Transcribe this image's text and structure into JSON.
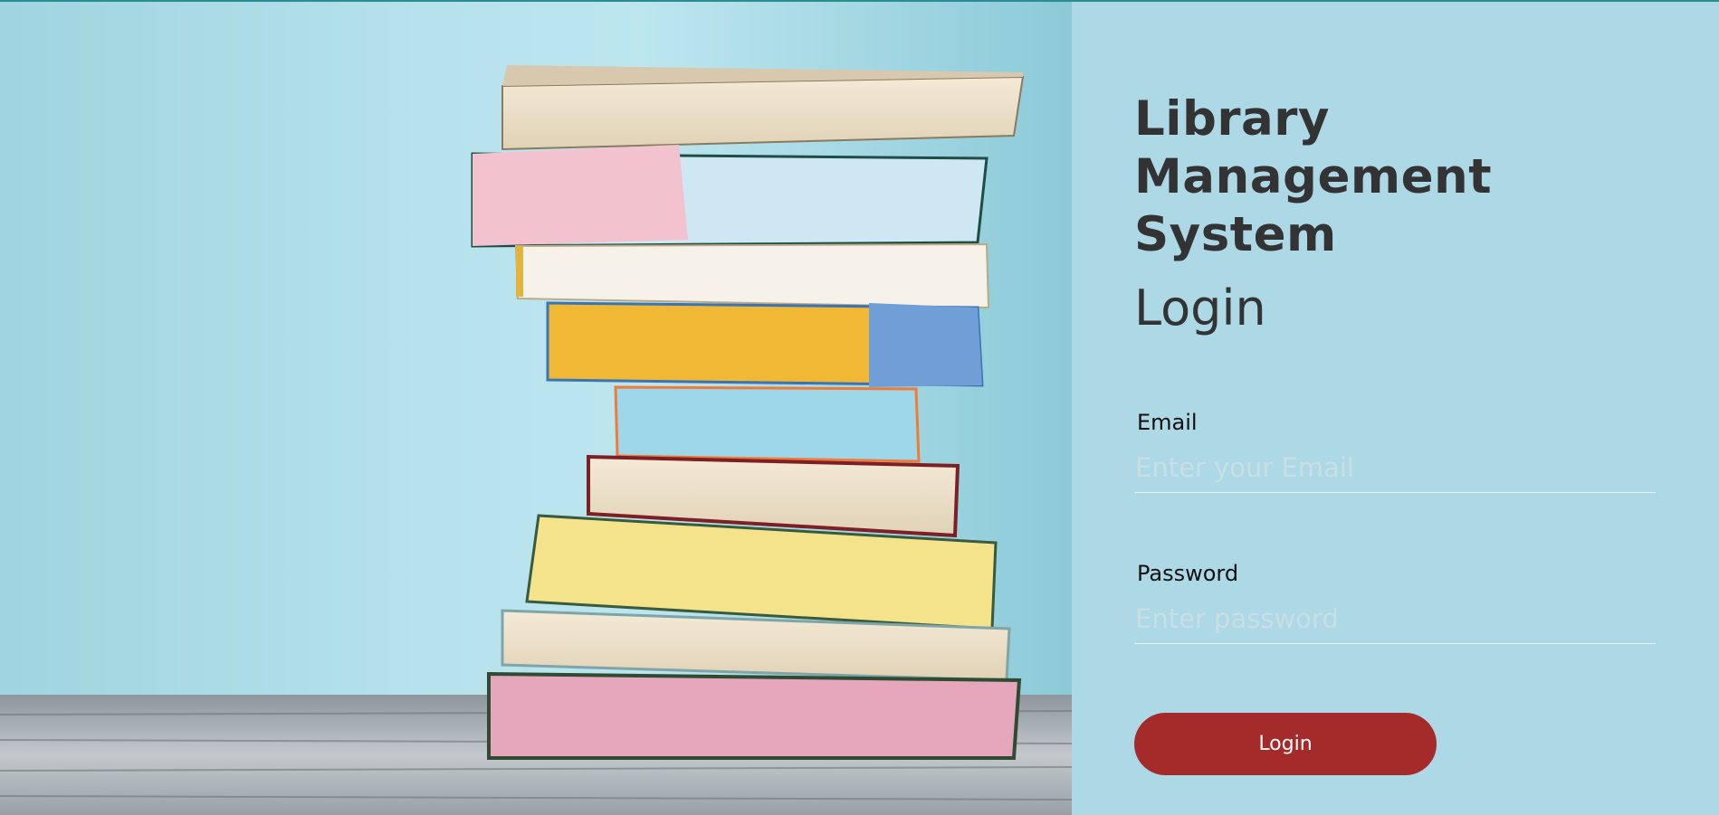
{
  "app": {
    "title": "Library Management System"
  },
  "login": {
    "heading": "Login",
    "email": {
      "label": "Email",
      "placeholder": "Enter your Email",
      "value": ""
    },
    "password": {
      "label": "Password",
      "placeholder": "Enter password",
      "value": ""
    },
    "submit_label": "Login"
  },
  "colors": {
    "panel_background": "#add8e6",
    "button": "#a52a2a",
    "title_text": "#333333"
  }
}
